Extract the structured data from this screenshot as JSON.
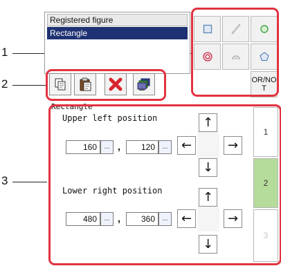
{
  "callouts": [
    "1",
    "2",
    "3"
  ],
  "registered": {
    "header": "Registered figure",
    "items": [
      "Rectangle"
    ]
  },
  "shape_buttons": {
    "icons": [
      "square-icon",
      "line-icon",
      "circle-icon",
      "ring-icon",
      "arc-icon",
      "polygon-icon"
    ],
    "ornot_line1": "OR/NO",
    "ornot_line2": "T"
  },
  "toolbar": {
    "icons": [
      "copy-icon",
      "paste-icon",
      "delete-icon",
      "display-icon"
    ]
  },
  "rectangle": {
    "title": "Rectangle",
    "upper_left_label": "Upper left position",
    "upper_left_x": "160",
    "upper_left_y": "120",
    "lower_right_label": "Lower right position",
    "lower_right_x": "480",
    "lower_right_y": "360",
    "dots": "...",
    "comma": ",",
    "arrows": {
      "up": "↑",
      "down": "↓",
      "left": "←",
      "right": "→"
    }
  },
  "point_tabs": [
    "1",
    "2",
    "3"
  ],
  "colors": {
    "highlight": "#e1323f",
    "selection": "#1e3273",
    "active_tab": "#b6dc9b"
  }
}
